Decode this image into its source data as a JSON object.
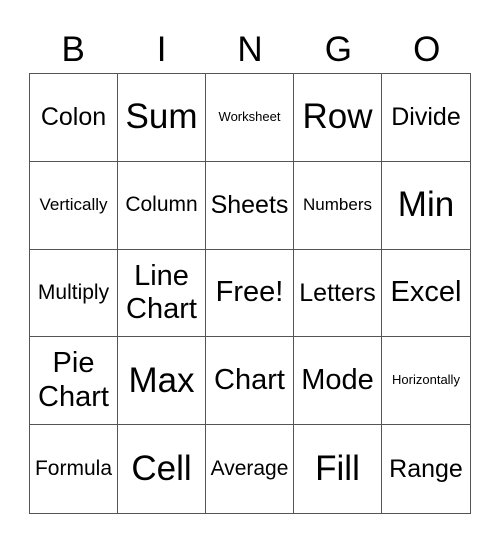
{
  "header": [
    "B",
    "I",
    "N",
    "G",
    "O"
  ],
  "cells": [
    [
      "Colon",
      "Sum",
      "Worksheet",
      "Row",
      "Divide"
    ],
    [
      "Vertically",
      "Column",
      "Sheets",
      "Numbers",
      "Min"
    ],
    [
      "Multiply",
      "Line Chart",
      "Free!",
      "Letters",
      "Excel"
    ],
    [
      "Pie Chart",
      "Max",
      "Chart",
      "Mode",
      "Horizontally"
    ],
    [
      "Formula",
      "Cell",
      "Average",
      "Fill",
      "Range"
    ]
  ]
}
